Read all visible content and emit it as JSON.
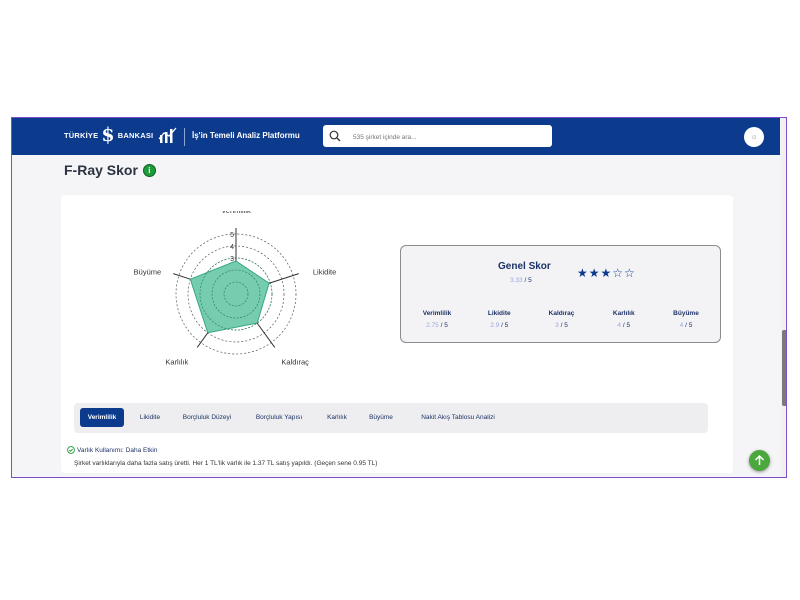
{
  "header": {
    "brand_part1": "TÜRKİYE",
    "brand_symbol": "$",
    "brand_part2": "BANKASI",
    "platform_title": "İş'in Temeli Analiz Platformu",
    "search_placeholder": "535 şirket içinde ara...",
    "avatar_icon": "sun-icon",
    "colors": {
      "primary": "#0c3a8c",
      "accent_green": "#1e9c3a",
      "radar_fill": "#5dc3a0"
    }
  },
  "page": {
    "title": "F-Ray Skor",
    "info_icon": "i"
  },
  "chart_data": {
    "type": "radar",
    "axes": [
      "Verimlilik",
      "Likidite",
      "Kaldıraç",
      "Karlılık",
      "Büyüme"
    ],
    "values": [
      2.75,
      2.9,
      3,
      4,
      4
    ],
    "ticks": [
      "5",
      "4",
      "3"
    ],
    "range": [
      0,
      5
    ]
  },
  "score": {
    "label": "Genel Skor",
    "value": "3.33",
    "max": "/ 5",
    "stars_filled": "★★★",
    "stars_empty": "☆☆",
    "rating": 3,
    "metrics": [
      {
        "label": "Verimlilik",
        "value": "2.75",
        "max": "/ 5"
      },
      {
        "label": "Likidite",
        "value": "2.9",
        "max": "/ 5"
      },
      {
        "label": "Kaldıraç",
        "value": "3",
        "max": "/ 5"
      },
      {
        "label": "Karlılık",
        "value": "4",
        "max": "/ 5"
      },
      {
        "label": "Büyüme",
        "value": "4",
        "max": "/ 5"
      }
    ]
  },
  "tabs": [
    "Verimlilik",
    "Likidite",
    "Borçluluk Düzeyi",
    "Borçluluk Yapısı",
    "Karlılık",
    "Büyüme",
    "Nakit Akış Tablosu Analizi"
  ],
  "details": {
    "status_label": "Varlık Kullanımı: Daha Etkin",
    "description": "Şirket varlıklarıyla daha fazla satış üretti. Her 1 TL'lik varlık ile 1.37 TL satış yapıldı. (Geçen sene 0.95 TL)"
  }
}
